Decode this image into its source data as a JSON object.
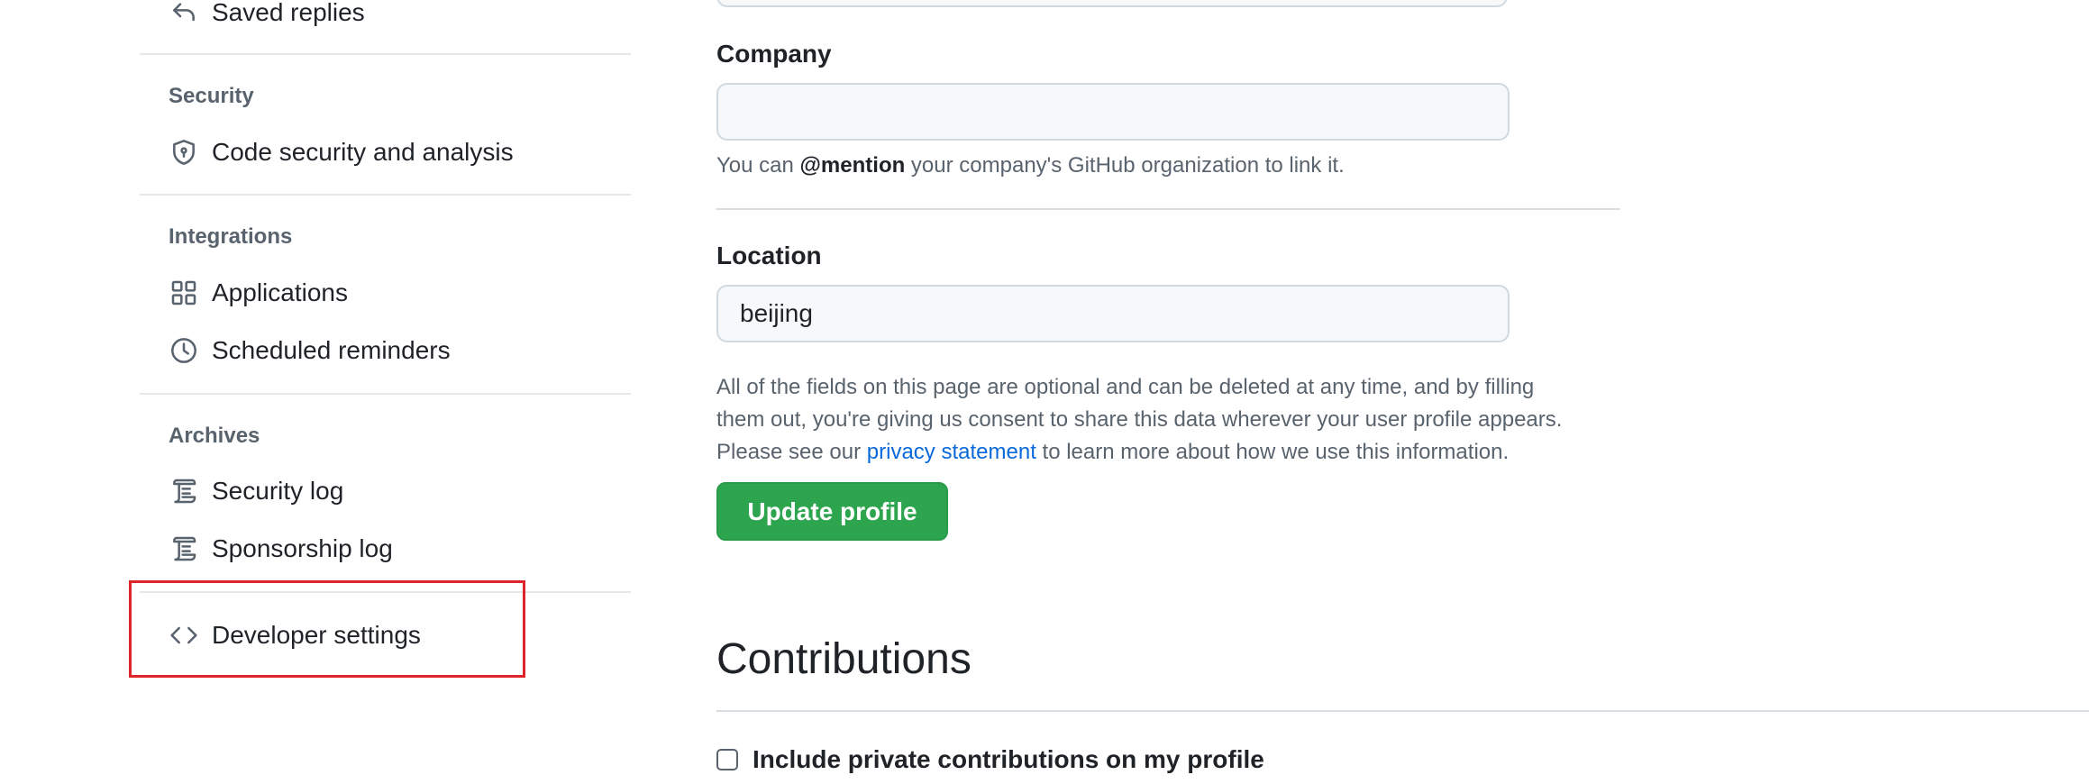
{
  "sidebar": {
    "saved_replies": {
      "label": "Saved replies",
      "icon": "reply-icon"
    },
    "sections": {
      "security": {
        "heading": "Security",
        "items": [
          {
            "label": "Code security and analysis",
            "icon": "shield-icon"
          }
        ]
      },
      "integrations": {
        "heading": "Integrations",
        "items": [
          {
            "label": "Applications",
            "icon": "apps-grid-icon"
          },
          {
            "label": "Scheduled reminders",
            "icon": "clock-icon"
          }
        ]
      },
      "archives": {
        "heading": "Archives",
        "items": [
          {
            "label": "Security log",
            "icon": "log-icon"
          },
          {
            "label": "Sponsorship log",
            "icon": "log-icon"
          }
        ]
      }
    },
    "developer_settings": {
      "label": "Developer settings",
      "icon": "code-icon"
    }
  },
  "main": {
    "company": {
      "label": "Company",
      "value": "",
      "placeholder": "",
      "hint_prefix": "You can ",
      "hint_mention": "@mention",
      "hint_suffix": " your company's GitHub organization to link it."
    },
    "location": {
      "label": "Location",
      "value": "beijing"
    },
    "disclaimer": {
      "line1": "All of the fields on this page are optional and can be deleted at any time, and by filling",
      "line2": "them out, you're giving us consent to share this data wherever your user profile appears.",
      "line3_prefix": "Please see our ",
      "line3_link": "privacy statement",
      "line3_suffix": " to learn more about how we use this information."
    },
    "update_button_label": "Update profile",
    "contributions": {
      "title": "Contributions",
      "checkbox_label": "Include private contributions on my profile",
      "checked": false
    }
  },
  "colors": {
    "primary_button": "#2da44e",
    "link": "#0969da",
    "highlight": "#e0252a",
    "muted_text": "#59636e"
  }
}
